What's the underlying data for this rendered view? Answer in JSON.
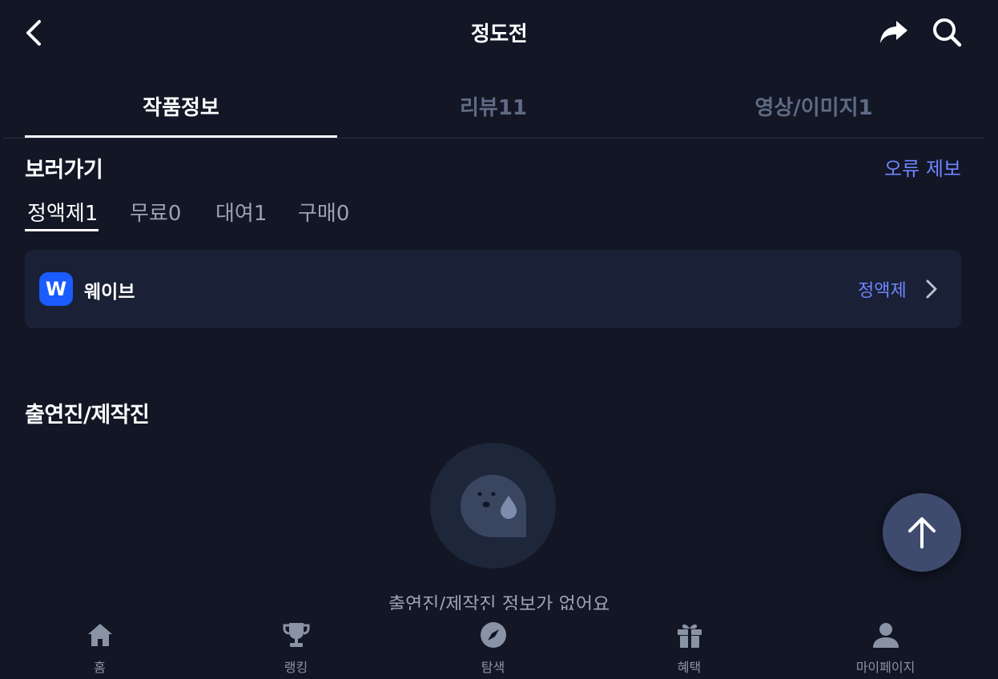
{
  "header": {
    "title": "정도전",
    "icons": [
      "back-icon",
      "share-icon",
      "search-icon"
    ]
  },
  "tabs": [
    {
      "label": "작품정보",
      "active": true
    },
    {
      "label": "리뷰11",
      "active": false
    },
    {
      "label": "영상/이미지1",
      "active": false
    }
  ],
  "watch": {
    "title": "보러가기",
    "report_label": "오류 제보",
    "sub_tabs": [
      {
        "label": "정액제1",
        "active": true
      },
      {
        "label": "무료0",
        "active": false
      },
      {
        "label": "대여1",
        "active": false
      },
      {
        "label": "구매0",
        "active": false
      }
    ],
    "platform": {
      "logo_letter": "W",
      "name": "웨이브",
      "type": "정액제"
    }
  },
  "cast": {
    "title": "출연진/제작진",
    "empty_text": "출연진/제작진 정보가 없어요"
  },
  "bottom_nav": [
    {
      "label": "홈",
      "icon": "home-icon"
    },
    {
      "label": "랭킹",
      "icon": "trophy-icon"
    },
    {
      "label": "탐색",
      "icon": "compass-icon"
    },
    {
      "label": "혜택",
      "icon": "gift-icon"
    },
    {
      "label": "마이페이지",
      "icon": "user-icon"
    }
  ],
  "colors": {
    "background": "#121625",
    "accent": "#6f86ff",
    "card": "#1a2035",
    "wavve": "#1a5cff"
  }
}
